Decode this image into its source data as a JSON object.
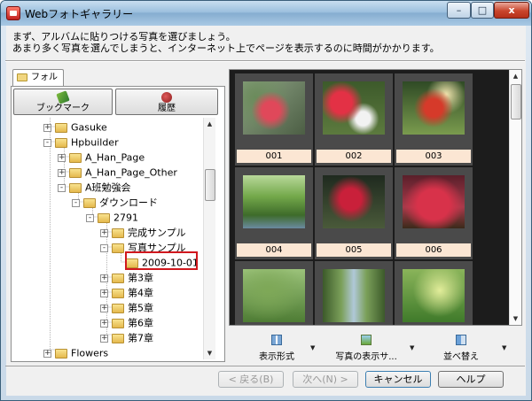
{
  "window": {
    "title": "Webフォトギャラリー",
    "close": "x",
    "minimize": "–",
    "maximize": "□"
  },
  "intro": {
    "line1": "まず、アルバムに貼りつける写真を選びましょう。",
    "line2": "あまり多く写真を選んでしまうと、インターネット上でページを表示するのに時間がかかります。"
  },
  "left": {
    "tab_label": "フォルダ",
    "bookmark_label": "ブックマーク",
    "history_label": "履歴"
  },
  "tree": {
    "items": [
      {
        "label": "Gasuke",
        "expander": "+"
      },
      {
        "label": "Hpbuilder",
        "expander": "-"
      },
      {
        "label": "A_Han_Page",
        "expander": "+"
      },
      {
        "label": "A_Han_Page_Other",
        "expander": "+"
      },
      {
        "label": "A班勉強会",
        "expander": "-"
      },
      {
        "label": "ダウンロード",
        "expander": "-"
      },
      {
        "label": "2791",
        "expander": "-"
      },
      {
        "label": "完成サンプル",
        "expander": "+"
      },
      {
        "label": "写真サンプル",
        "expander": "-"
      },
      {
        "label": "2009-10-01",
        "expander": ""
      },
      {
        "label": "第3章",
        "expander": "+"
      },
      {
        "label": "第4章",
        "expander": "+"
      },
      {
        "label": "第5章",
        "expander": "+"
      },
      {
        "label": "第6章",
        "expander": "+"
      },
      {
        "label": "第7章",
        "expander": "+"
      },
      {
        "label": "Flowers",
        "expander": "+"
      }
    ]
  },
  "gallery": {
    "thumbs": [
      {
        "label": "001"
      },
      {
        "label": "002"
      },
      {
        "label": "003"
      },
      {
        "label": "004"
      },
      {
        "label": "005"
      },
      {
        "label": "006"
      },
      {
        "label": ""
      },
      {
        "label": ""
      },
      {
        "label": ""
      }
    ],
    "toolbar": {
      "view_format": "表示形式",
      "photo_display": "写真の表示サ...",
      "sort": "並べ替え"
    }
  },
  "footer": {
    "back": "< 戻る(B)",
    "next": "次へ(N) >",
    "cancel": "キャンセル",
    "help": "ヘルプ"
  },
  "colors": {
    "thumb_label_bg": "#fbe6d3",
    "gallery_bg": "#1c1c1c",
    "selection_border": "#d0181e"
  }
}
